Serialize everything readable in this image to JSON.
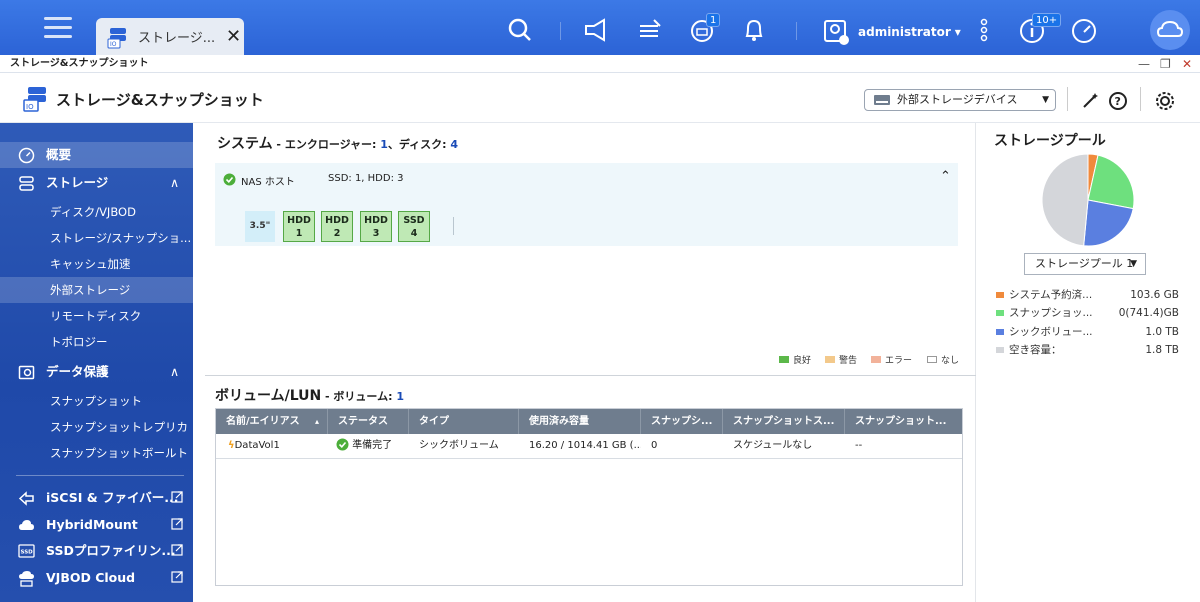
{
  "topbar": {
    "app_tab_title": "ストレージ...",
    "app_tab_close": "✕",
    "update_badge": "1",
    "info_badge": "10+",
    "username": "administrator",
    "username_caret": "▾"
  },
  "window": {
    "title": "ストレージ&スナップショット",
    "controls": [
      "—",
      "❐",
      "✕"
    ]
  },
  "header": {
    "title": "ストレージ&スナップショット",
    "external_device_select": "外部ストレージデバイス"
  },
  "sidebar": {
    "items": [
      {
        "label": "概要",
        "selected": true,
        "icon": "dashboard-icon"
      },
      {
        "label": "ストレージ",
        "icon": "storage-icon",
        "chevron": "∧"
      },
      {
        "label": "ディスク/VJBOD"
      },
      {
        "label": "ストレージ/スナップショ..."
      },
      {
        "label": "キャッシュ加速"
      },
      {
        "label": "外部ストレージ",
        "selected": true
      },
      {
        "label": "リモートディスク"
      },
      {
        "label": "トポロジー"
      },
      {
        "label": "データ保護",
        "icon": "data-protection-icon",
        "chevron": "∧"
      },
      {
        "label": "スナップショット"
      },
      {
        "label": "スナップショットレプリカ"
      },
      {
        "label": "スナップショットボールト"
      },
      {
        "label": "iSCSI & ファイバー...",
        "icon": "iscsi-icon"
      },
      {
        "label": "HybridMount",
        "icon": "cloud-icon"
      },
      {
        "label": "SSDプロファイリン...",
        "icon": "ssd-icon"
      },
      {
        "label": "VJBOD Cloud",
        "icon": "vjbod-cloud-icon"
      }
    ]
  },
  "system": {
    "title": "システム",
    "enclosure_label": " - エンクロージャー: ",
    "enclosure_count": "1",
    "disk_sep": "、ディスク: ",
    "disk_count": "4",
    "host_label": "NAS ホスト",
    "host_disks": "SSD: 1, HDD: 3",
    "slot_size": "3.5\"",
    "bays": [
      {
        "type": "HDD",
        "num": "1"
      },
      {
        "type": "HDD",
        "num": "2"
      },
      {
        "type": "HDD",
        "num": "3"
      },
      {
        "type": "SSD",
        "num": "4"
      }
    ],
    "legend": [
      {
        "label": "良好",
        "color": "#5cb84a"
      },
      {
        "label": "警告",
        "color": "#f3c98b"
      },
      {
        "label": "エラー",
        "color": "#f2b29a"
      },
      {
        "label": "なし",
        "color": "#ffffff"
      }
    ]
  },
  "volumes": {
    "title": "ボリューム/LUN",
    "count_label": " - ボリューム: ",
    "count": "1",
    "columns": [
      "名前/エイリアス",
      "ステータス",
      "タイプ",
      "使用済み容量",
      "スナップシ...",
      "スナップショットス...",
      "スナップショット..."
    ],
    "sort_indicator": "▴",
    "rows": [
      {
        "name": "DataVol1",
        "status": "準備完了",
        "type": "シックボリューム",
        "used": "16.20 / 1014.41 GB (...",
        "snapshots": "0",
        "schedule": "スケジュールなし",
        "last": "--"
      }
    ]
  },
  "storage_pool": {
    "title": "ストレージプール",
    "select": "ストレージプール 1",
    "legend": [
      {
        "label": "システム予約済...",
        "value": "103.6 GB",
        "color": "#f08a3c"
      },
      {
        "label": "スナップショッ...",
        "value": "0(741.4)GB",
        "color": "#6ee07e"
      },
      {
        "label": "シックボリュー...",
        "value": "1.0 TB",
        "color": "#5a7fe0"
      },
      {
        "label": "空き容量：",
        "value": "1.8 TB",
        "color": "#d4d6da"
      }
    ],
    "pie_fractions": [
      0.035,
      0.245,
      0.235,
      0.485
    ]
  },
  "colors": {
    "topbar": "#2f6ad9",
    "sidebar": "#2350b0",
    "accent": "#1a4bb7",
    "table_header": "#6f7d8e",
    "bay_fill": "#bfe9b5"
  }
}
